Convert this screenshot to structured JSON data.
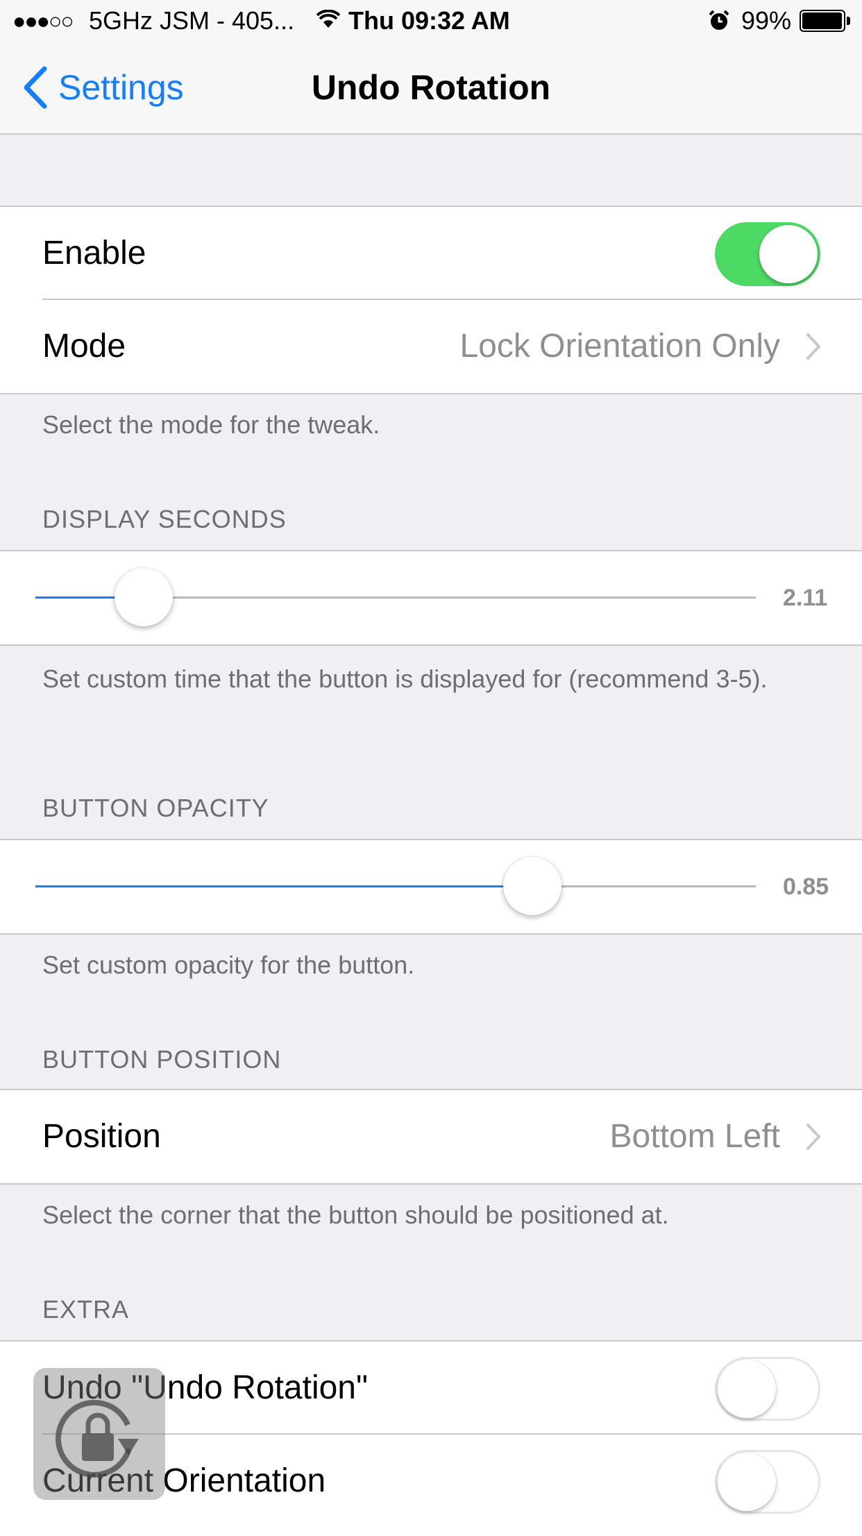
{
  "status_bar": {
    "signal_dots": "●●●○○",
    "carrier": "5GHz JSM - 405...",
    "time": "Thu 09:32 AM",
    "battery_percent": "99%",
    "battery_level": 0.99,
    "icons": [
      "signal-dots-icon",
      "wifi-icon",
      "alarm-icon",
      "battery-icon"
    ]
  },
  "nav": {
    "back_label": "Settings",
    "title": "Undo Rotation",
    "accent_color": "#147efb"
  },
  "general": {
    "enable_label": "Enable",
    "enable_on": true,
    "mode_label": "Mode",
    "mode_value": "Lock Orientation Only",
    "mode_footer": "Select the mode for the tweak."
  },
  "display_seconds": {
    "header": "DISPLAY SECONDS",
    "value_text": "2.11",
    "fraction": 0.15,
    "footer": "Set custom time that the button is displayed for (recommend 3-5)."
  },
  "button_opacity": {
    "header": "BUTTON OPACITY",
    "value_text": "0.85",
    "fraction": 0.69,
    "footer": "Set custom opacity for the button."
  },
  "button_position": {
    "header": "BUTTON POSITION",
    "position_label": "Position",
    "position_value": "Bottom Left",
    "footer": "Select the corner that the button should be positioned at."
  },
  "extra": {
    "header": "EXTRA",
    "undo_label": "Undo \"Undo Rotation\"",
    "undo_on": false,
    "current_label": "Current Orientation",
    "current_on": false
  },
  "colors": {
    "switch_on": "#4cd964",
    "background": "#efeff4",
    "secondary_text": "#8e8e93"
  },
  "overlay": {
    "icon": "rotation-lock-icon"
  }
}
